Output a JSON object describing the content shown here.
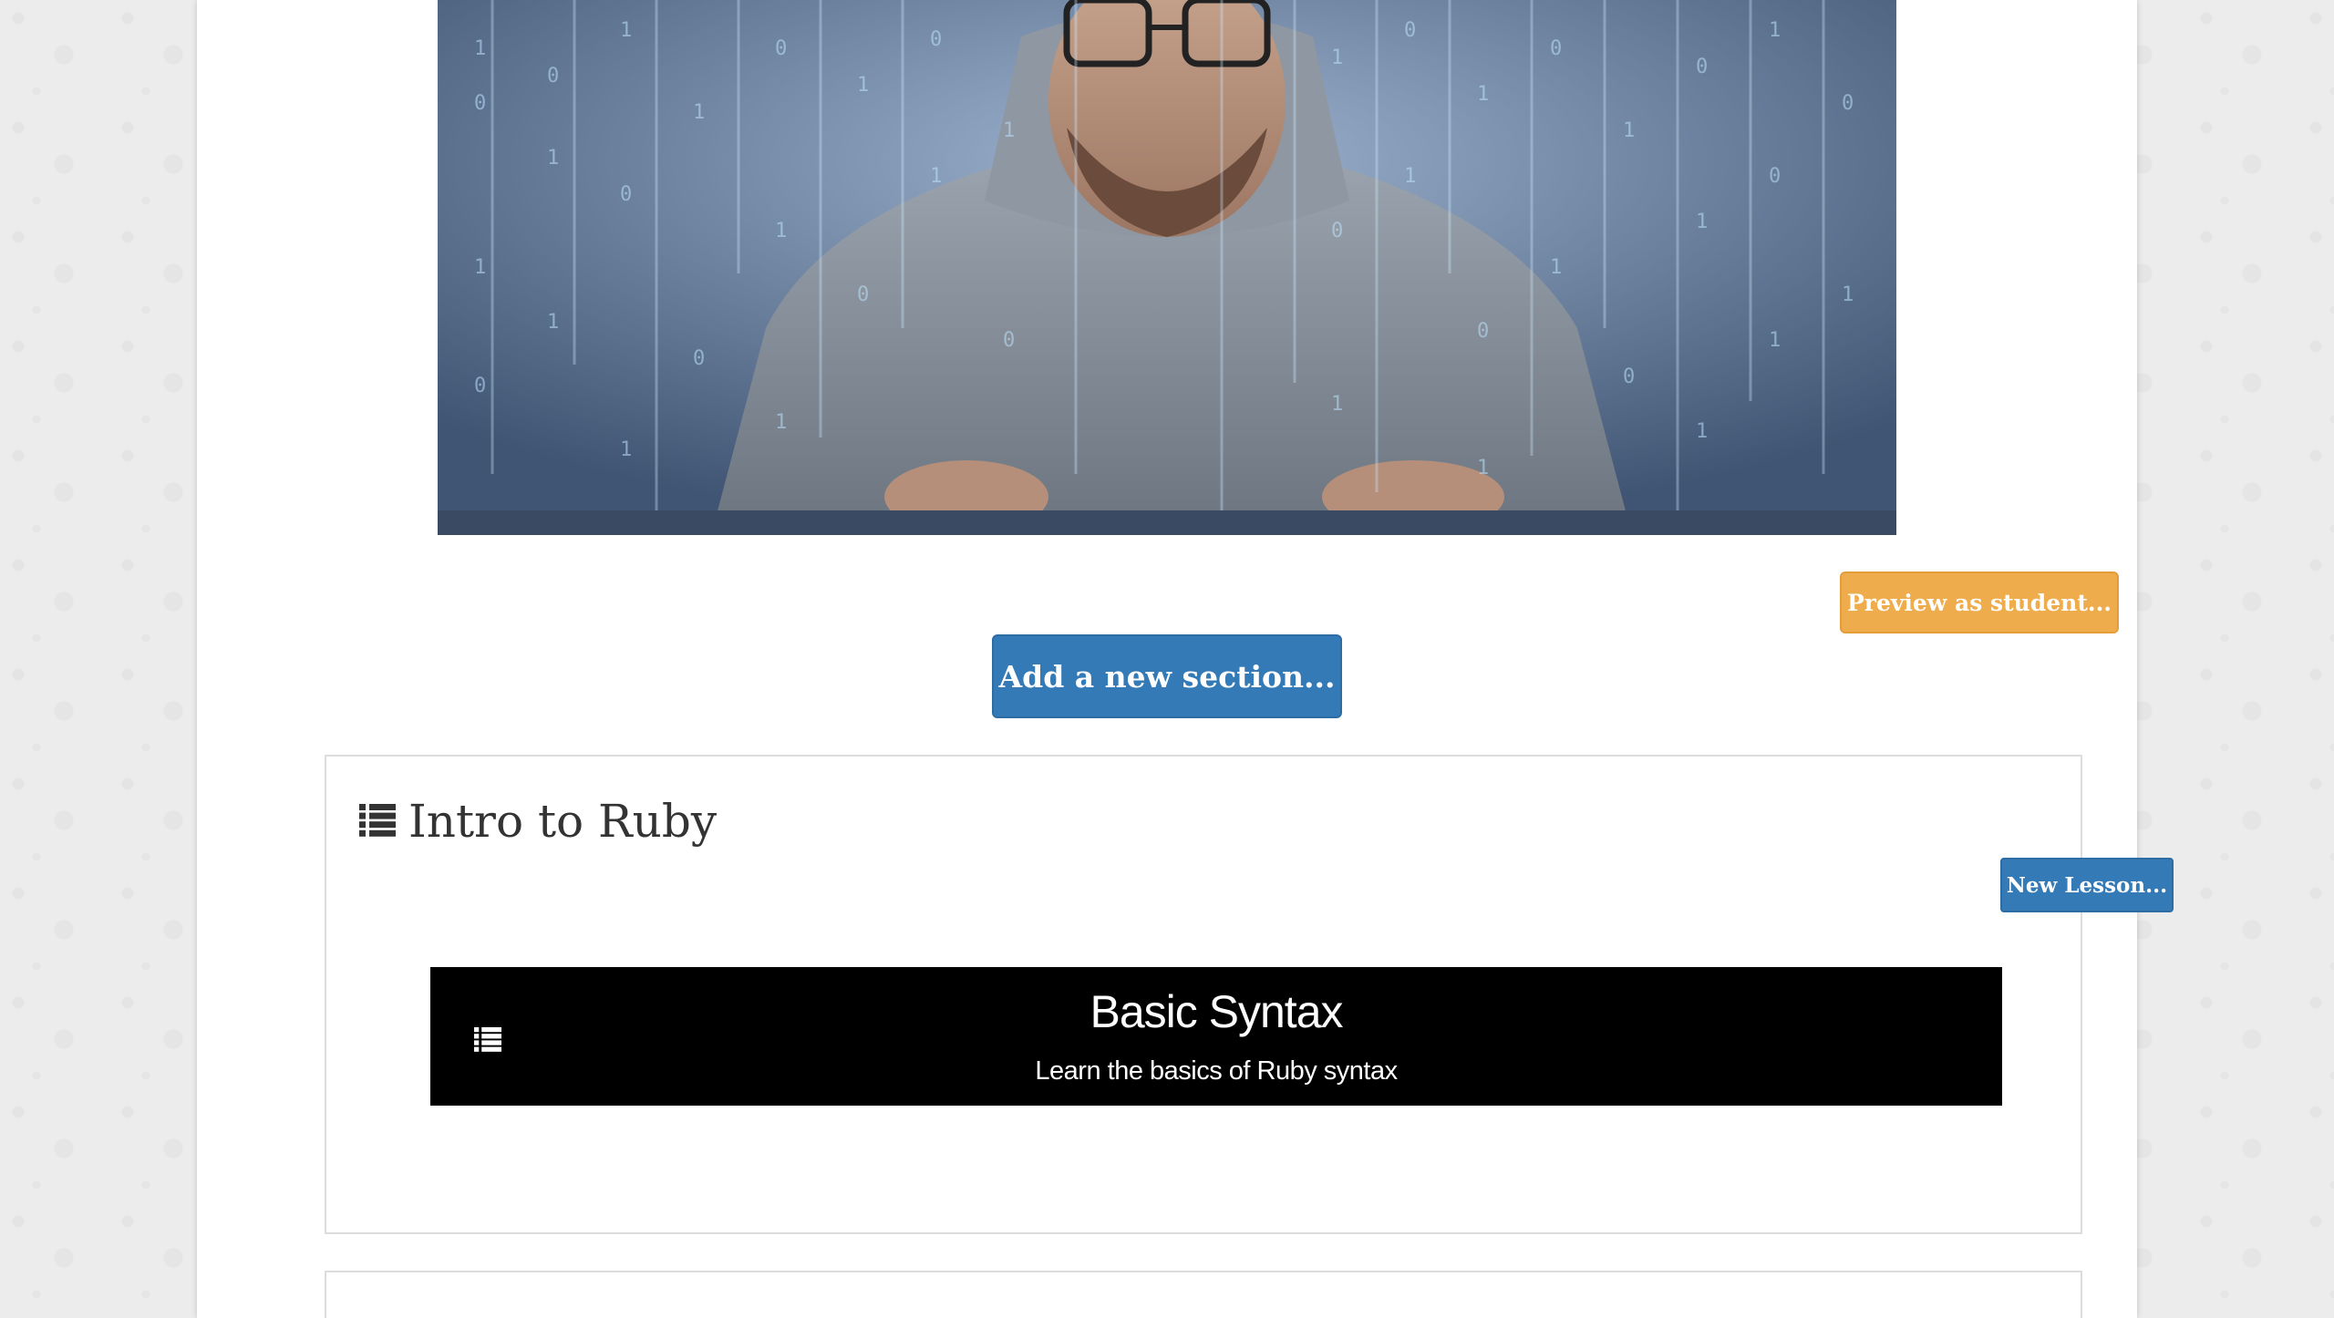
{
  "hero": {
    "image_description_icon": "hacker-at-keyboard-image"
  },
  "actions": {
    "preview_label": "Preview as student...",
    "add_section_label": "Add a new section..."
  },
  "section": {
    "icon": "list-icon",
    "title": "Intro to Ruby",
    "new_lesson_label": "New Lesson...",
    "lessons": [
      {
        "icon": "list-icon",
        "title": "Basic Syntax",
        "subtitle": "Learn the basics of Ruby syntax"
      }
    ]
  },
  "colors": {
    "primary": "#337ab7",
    "warning": "#efac4d",
    "lesson_bg": "#000000",
    "page_bg": "#ececec"
  }
}
